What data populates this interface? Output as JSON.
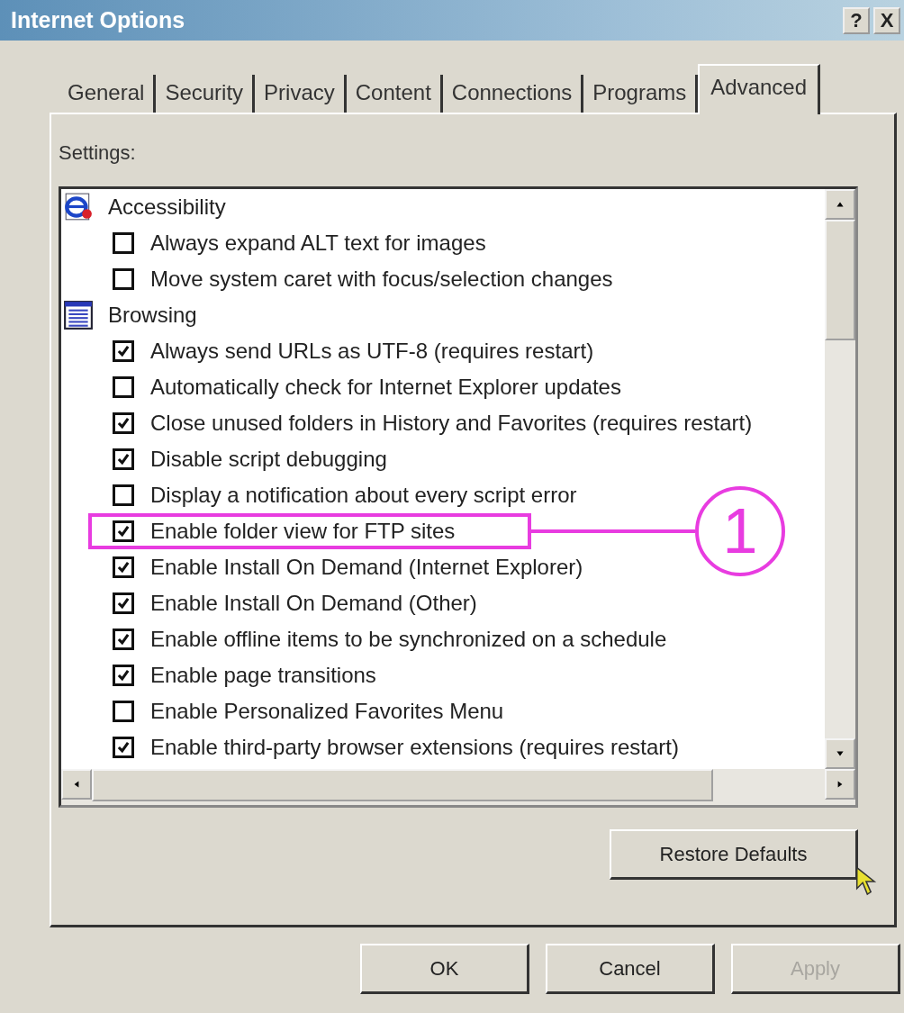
{
  "window": {
    "title": "Internet Options",
    "title_buttons": [
      "?",
      "X"
    ]
  },
  "tabs": [
    {
      "label": "General",
      "selected": false
    },
    {
      "label": "Security",
      "selected": false
    },
    {
      "label": "Privacy",
      "selected": false
    },
    {
      "label": "Content",
      "selected": false
    },
    {
      "label": "Connections",
      "selected": false
    },
    {
      "label": "Programs",
      "selected": false
    },
    {
      "label": "Advanced",
      "selected": true
    }
  ],
  "settings_label": "Settings:",
  "categories": [
    {
      "label": "Accessibility",
      "children": [
        {
          "label": "Always expand ALT text for images",
          "checked": false,
          "highlighted": false
        },
        {
          "label": "Move system caret with focus/selection changes",
          "checked": false,
          "highlighted": false
        }
      ]
    },
    {
      "label": "Browsing",
      "children": [
        {
          "label": "Always send URLs as UTF-8 (requires restart)",
          "checked": true,
          "highlighted": false
        },
        {
          "label": "Automatically check for Internet Explorer updates",
          "checked": false,
          "highlighted": false
        },
        {
          "label": "Close unused folders in History and Favorites (requires restart)",
          "checked": true,
          "highlighted": false
        },
        {
          "label": "Disable script debugging",
          "checked": true,
          "highlighted": false
        },
        {
          "label": "Display a notification about every script error",
          "checked": false,
          "highlighted": false
        },
        {
          "label": "Enable folder view for FTP sites",
          "checked": true,
          "highlighted": true
        },
        {
          "label": "Enable Install On Demand (Internet Explorer)",
          "checked": true,
          "highlighted": false
        },
        {
          "label": "Enable Install On Demand (Other)",
          "checked": true,
          "highlighted": false
        },
        {
          "label": "Enable offline items to be synchronized on a schedule",
          "checked": true,
          "highlighted": false
        },
        {
          "label": "Enable page transitions",
          "checked": true,
          "highlighted": false
        },
        {
          "label": "Enable Personalized Favorites Menu",
          "checked": false,
          "highlighted": false
        },
        {
          "label": "Enable third-party browser extensions (requires restart)",
          "checked": true,
          "highlighted": false
        }
      ]
    }
  ],
  "callout": {
    "number": "1"
  },
  "restore_button": "Restore Defaults",
  "buttons": [
    {
      "label": "OK",
      "disabled": false
    },
    {
      "label": "Cancel",
      "disabled": false
    },
    {
      "label": "Apply",
      "disabled": true
    }
  ]
}
